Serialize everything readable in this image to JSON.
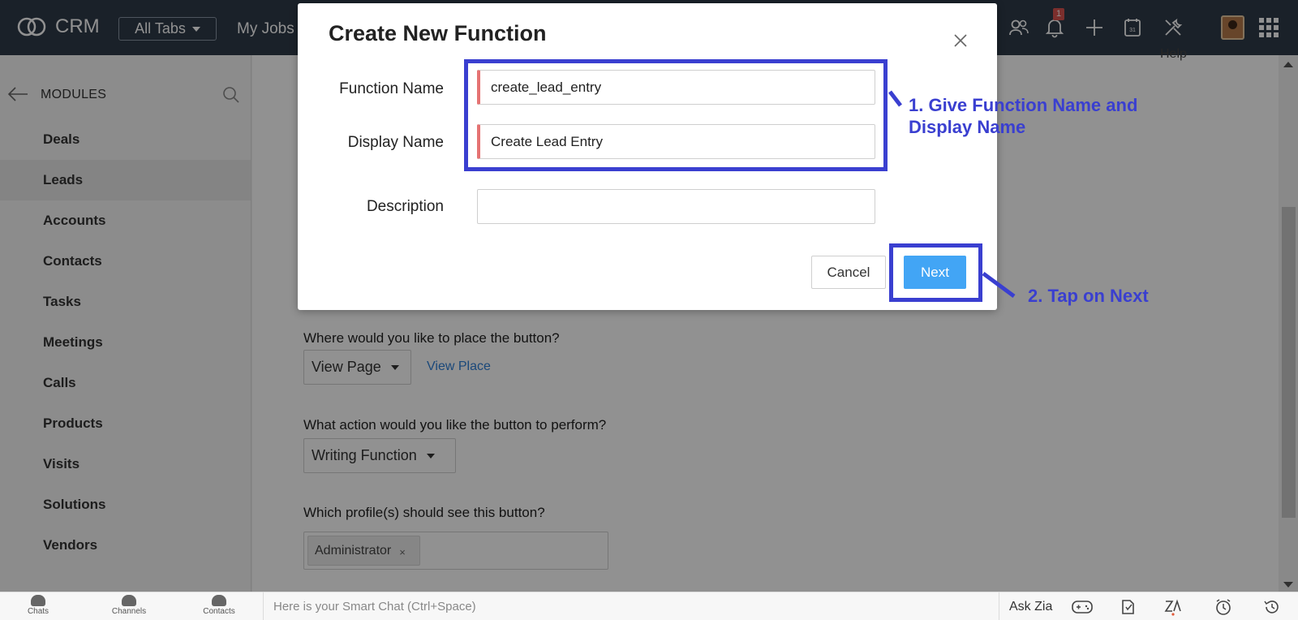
{
  "topbar": {
    "logo_text": "CRM",
    "all_tabs_label": "All Tabs",
    "partial_tab_label": "My Jobs",
    "notification_count": "1",
    "icons": [
      "contacts-people-icon",
      "bell-icon",
      "plus-icon",
      "calendar-icon",
      "tools-icon",
      "avatar",
      "apps-grid-icon"
    ]
  },
  "sidebar": {
    "header": "MODULES",
    "items": [
      {
        "label": "Deals"
      },
      {
        "label": "Leads"
      },
      {
        "label": "Accounts"
      },
      {
        "label": "Contacts"
      },
      {
        "label": "Tasks"
      },
      {
        "label": "Meetings"
      },
      {
        "label": "Calls"
      },
      {
        "label": "Products"
      },
      {
        "label": "Visits"
      },
      {
        "label": "Solutions"
      },
      {
        "label": "Vendors"
      }
    ]
  },
  "main": {
    "help_label": "Help",
    "place_question": "Where would you like to place the button?",
    "place_value": "View Page",
    "view_place_link": "View Place",
    "action_question": "What action would you like the button to perform?",
    "action_value": "Writing Function",
    "profile_question": "Which profile(s) should see this button?",
    "profile_chip": "Administrator",
    "chip_remove": "×"
  },
  "modal": {
    "title": "Create New Function",
    "close_glyph": "×",
    "function_name_label": "Function Name",
    "function_name_value": "create_lead_entry",
    "display_name_label": "Display Name",
    "display_name_value": "Create Lead Entry",
    "description_label": "Description",
    "description_value": "",
    "cancel_label": "Cancel",
    "next_label": "Next"
  },
  "annotations": {
    "step1_line1": "1. Give Function Name and",
    "step1_line2": "Display Name",
    "step2": "2. Tap on Next",
    "color": "#3a3fd0"
  },
  "bottombar": {
    "items": [
      {
        "label": "Chats"
      },
      {
        "label": "Channels"
      },
      {
        "label": "Contacts"
      }
    ],
    "chat_placeholder": "Here is your Smart Chat (Ctrl+Space)",
    "ask_zia": "Ask Zia"
  }
}
